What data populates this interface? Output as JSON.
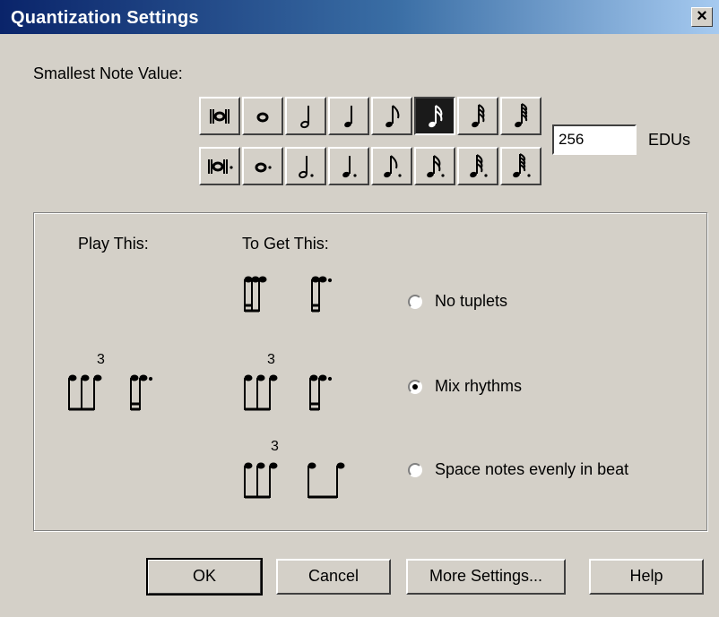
{
  "window": {
    "title": "Quantization Settings",
    "close_label": "×"
  },
  "smallest_note": {
    "label": "Smallest Note Value:",
    "rows": [
      [
        "double-whole-note",
        "whole-note",
        "half-note",
        "quarter-note",
        "eighth-note",
        "sixteenth-note",
        "thirty-second-note",
        "sixty-fourth-note"
      ],
      [
        "dotted-double-whole-note",
        "dotted-whole-note",
        "dotted-half-note",
        "dotted-quarter-note",
        "dotted-eighth-note",
        "dotted-sixteenth-note",
        "dotted-thirty-second-note",
        "dotted-sixty-fourth-note"
      ]
    ],
    "selected": "sixteenth-note",
    "edu_value": "256",
    "edu_label": "EDUs"
  },
  "group": {
    "play_label": "Play This:",
    "get_label": "To Get This:",
    "tuplet_numbers": [
      "3",
      "3",
      "3"
    ],
    "options": [
      {
        "label": "No tuplets",
        "checked": false
      },
      {
        "label": "Mix rhythms",
        "checked": true
      },
      {
        "label": "Space notes evenly in beat",
        "checked": false
      }
    ]
  },
  "buttons": {
    "ok": "OK",
    "cancel": "Cancel",
    "more": "More Settings...",
    "help": "Help"
  }
}
